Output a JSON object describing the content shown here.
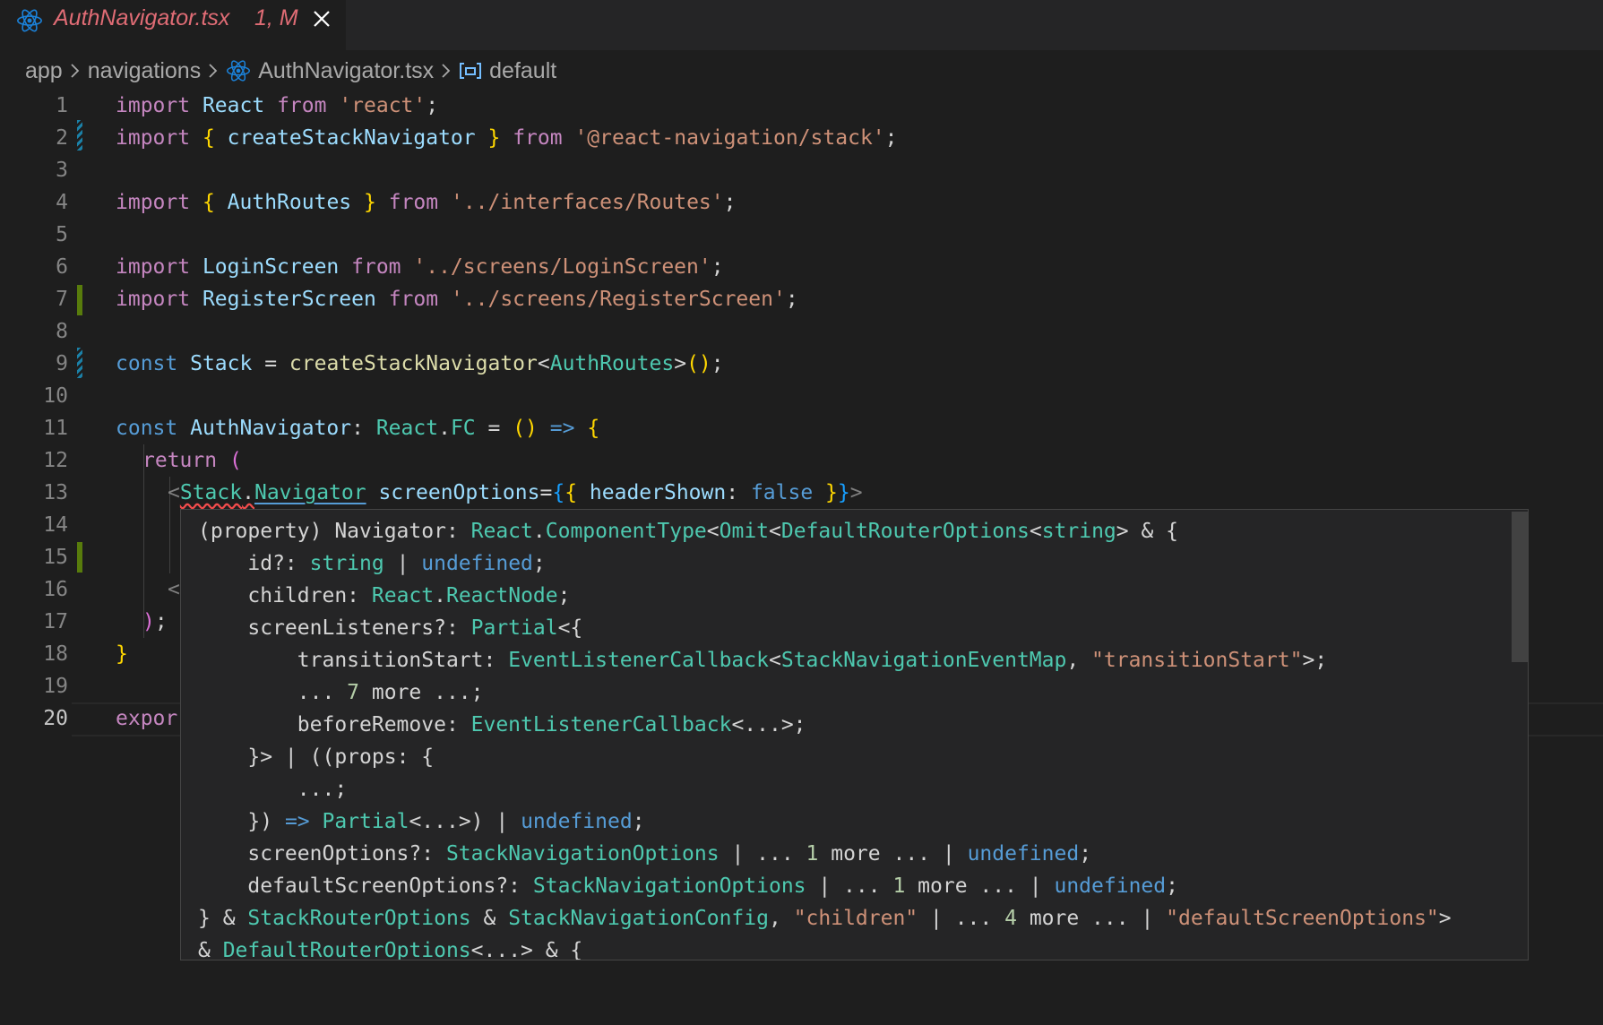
{
  "tab": {
    "title": "AuthNavigator.tsx",
    "status": "1, M",
    "icon": "react-icon",
    "close_icon": "close-icon"
  },
  "breadcrumb": {
    "items": [
      "app",
      "navigations",
      "AuthNavigator.tsx",
      "default"
    ]
  },
  "line_numbers": [
    "1",
    "2",
    "3",
    "4",
    "5",
    "6",
    "7",
    "8",
    "9",
    "10",
    "11",
    "12",
    "13",
    "14",
    "15",
    "16",
    "17",
    "18",
    "19",
    "20"
  ],
  "active_line": "20",
  "code": {
    "l1": [
      "import",
      " ",
      "React",
      " ",
      "from",
      " ",
      "'react'",
      ";"
    ],
    "l2": [
      "import",
      " ",
      "{",
      " ",
      "createStackNavigator",
      " ",
      "}",
      " ",
      "from",
      " ",
      "'@react-navigation/stack'",
      ";"
    ],
    "l4": [
      "import",
      " ",
      "{",
      " ",
      "AuthRoutes",
      " ",
      "}",
      " ",
      "from",
      " ",
      "'../interfaces/Routes'",
      ";"
    ],
    "l6": [
      "import",
      " ",
      "LoginScreen",
      " ",
      "from",
      " ",
      "'../screens/LoginScreen'",
      ";"
    ],
    "l7": [
      "import",
      " ",
      "RegisterScreen",
      " ",
      "from",
      " ",
      "'../screens/RegisterScreen'",
      ";"
    ],
    "l9": [
      "const",
      " ",
      "Stack",
      " = ",
      "createStackNavigator",
      "<",
      "AuthRoutes",
      ">",
      "(",
      ")",
      ";"
    ],
    "l11": [
      "const",
      " ",
      "AuthNavigator",
      ": ",
      "React",
      ".",
      "FC",
      " = ",
      "(",
      ")",
      " ",
      "=>",
      " ",
      "{"
    ],
    "l12": [
      "return",
      " ",
      "("
    ],
    "l13": [
      "<",
      "Stack",
      ".",
      "Navigator",
      " ",
      "screenOptions",
      "=",
      "{",
      "{",
      " ",
      "headerShown",
      ": ",
      "false",
      " ",
      "}",
      "}",
      ">"
    ],
    "l16": [
      "<"
    ],
    "l17": [
      ")",
      ";"
    ],
    "l18": [
      "}"
    ],
    "l20": [
      "expor"
    ]
  },
  "hover": {
    "lines": [
      [
        "(property) Navigator: ",
        "React",
        ".",
        "ComponentType",
        "<",
        "Omit",
        "<",
        "DefaultRouterOptions",
        "<",
        "string",
        "> & {"
      ],
      [
        "    id?: ",
        "string",
        " | ",
        "undefined",
        ";"
      ],
      [
        "    children: ",
        "React",
        ".",
        "ReactNode",
        ";"
      ],
      [
        "    screenListeners?: ",
        "Partial",
        "<{"
      ],
      [
        "        transitionStart: ",
        "EventListenerCallback",
        "<",
        "StackNavigationEventMap",
        ", ",
        "\"transitionStart\"",
        ">;"
      ],
      [
        "        ... ",
        "7",
        " more ...;"
      ],
      [
        "        beforeRemove: ",
        "EventListenerCallback",
        "<...>;"
      ],
      [
        "    }> | ((",
        "props",
        ": {"
      ],
      [
        "        ...;"
      ],
      [
        "    }) ",
        "=>",
        " ",
        "Partial",
        "<...>) | ",
        "undefined",
        ";"
      ],
      [
        "    screenOptions?: ",
        "StackNavigationOptions",
        " | ... ",
        "1",
        " more ... | ",
        "undefined",
        ";"
      ],
      [
        "    defaultScreenOptions?: ",
        "StackNavigationOptions",
        " | ... ",
        "1",
        " more ... | ",
        "undefined",
        ";"
      ],
      [
        "} & ",
        "StackRouterOptions",
        " & ",
        "StackNavigationConfig",
        ", ",
        "\"children\"",
        " | ... ",
        "4",
        " more ... | ",
        "\"defaultScreenOptions\"",
        ">"
      ],
      [
        "& ",
        "DefaultRouterOptions",
        "<...> & {"
      ]
    ]
  },
  "colors": {
    "background": "#1e1e1e",
    "keyword": "#c586c0",
    "storage": "#569cd6",
    "variable": "#9cdcfe",
    "function": "#dcdcaa",
    "type": "#4ec9b0",
    "string": "#ce9178",
    "error": "#f14c4c",
    "tab_title": "#e06c75"
  }
}
